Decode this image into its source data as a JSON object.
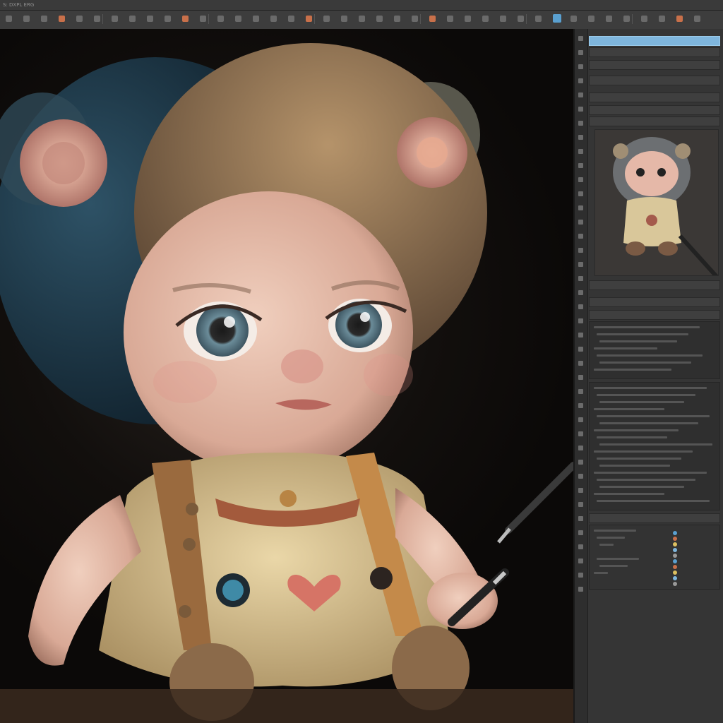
{
  "menubar": {
    "items": [
      "S: DXPL ERG",
      "",
      "",
      ""
    ]
  },
  "toolbar": {
    "buttons": [
      "tool-1",
      "tool-2",
      "tool-3",
      "tool-4",
      "tool-5",
      "tool-6",
      "tool-7",
      "tool-8",
      "tool-9",
      "tool-10",
      "tool-11",
      "tool-12",
      "tool-13",
      "tool-14",
      "tool-15",
      "tool-16",
      "tool-17",
      "tool-18",
      "tool-19",
      "tool-20",
      "tool-21",
      "tool-22",
      "tool-23",
      "tool-24",
      "tool-25",
      "tool-26",
      "tool-27",
      "tool-28",
      "tool-29",
      "tool-30",
      "tool-31",
      "tool-32",
      "tool-33",
      "tool-34",
      "tool-35",
      "tool-36",
      "tool-37",
      "tool-38",
      "tool-39",
      "tool-40"
    ]
  },
  "canvas": {
    "subject": "doll-character-illustration"
  },
  "panel": {
    "selected_layer": ""
  },
  "colors": {
    "accent": "#5aa0d0",
    "panel_bg": "#353535",
    "toolbar_bg": "#3d3d3d",
    "selection": "#7fb6dd"
  }
}
